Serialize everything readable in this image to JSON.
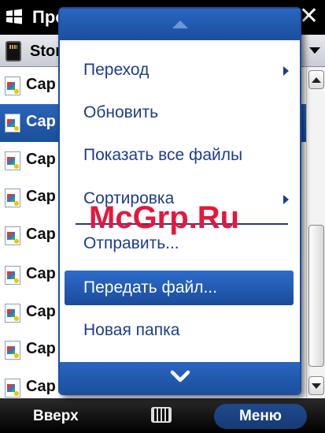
{
  "titlebar": {
    "title": "Про"
  },
  "location": {
    "label": "Stor"
  },
  "files": [
    {
      "name": "Cap"
    },
    {
      "name": "Cap"
    },
    {
      "name": "Cap"
    },
    {
      "name": "Cap"
    },
    {
      "name": "Cap"
    },
    {
      "name": "Cap"
    },
    {
      "name": "Cap"
    },
    {
      "name": "Cap"
    },
    {
      "name": "Cap"
    }
  ],
  "menu": {
    "items": [
      {
        "label": "Переход",
        "submenu": true
      },
      {
        "label": "Обновить",
        "submenu": false
      },
      {
        "label": "Показать все файлы",
        "submenu": false
      },
      {
        "label": "Сортировка",
        "submenu": true
      },
      {
        "label": "Отправить...",
        "submenu": false
      },
      {
        "label": "Передать файл...",
        "submenu": false
      },
      {
        "label": "Новая папка",
        "submenu": false
      }
    ]
  },
  "softkeys": {
    "left": "Вверх",
    "right": "Меню"
  },
  "watermark": "McGrp.Ru",
  "colors": {
    "accent": "#1c4e9f",
    "menu_text": "#1d3d8a",
    "watermark": "#e4173d"
  }
}
